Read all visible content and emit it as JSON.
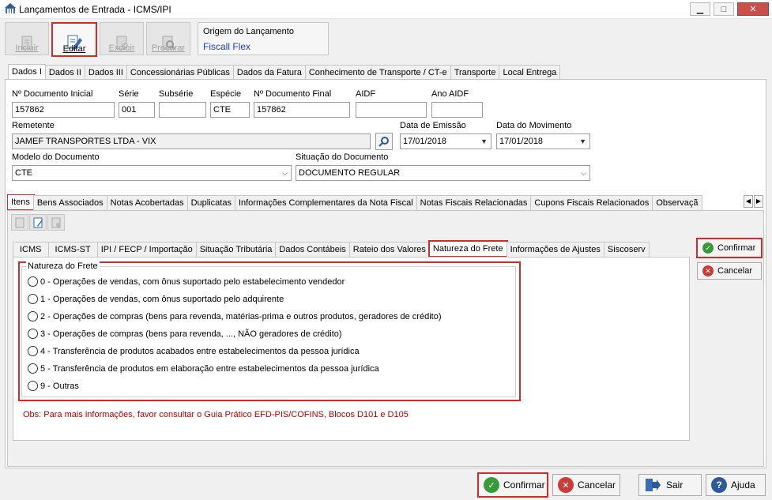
{
  "window": {
    "title": "Lançamentos de Entrada - ICMS/IPI"
  },
  "toolbar": {
    "incluir": "Incluir",
    "editar": "Editar",
    "excluir": "Excluir",
    "procurar": "Procurar"
  },
  "origem": {
    "title": "Origem do Lançamento",
    "value": "Fiscall Flex"
  },
  "main_tabs": [
    "Dados I",
    "Dados II",
    "Dados III",
    "Concessionárias Públicas",
    "Dados da Fatura",
    "Conhecimento de Transporte / CT-e",
    "Transporte",
    "Local Entrega"
  ],
  "form": {
    "num_doc_inicial_label": "Nº Documento Inicial",
    "num_doc_inicial": "157862",
    "serie_label": "Série",
    "serie": "001",
    "subserie_label": "Subsérie",
    "subserie": "",
    "especie_label": "Espécie",
    "especie": "CTE",
    "num_doc_final_label": "Nº Documento Final",
    "num_doc_final": "157862",
    "aidf_label": "AIDF",
    "aidf": "",
    "ano_aidf_label": "Ano AIDF",
    "ano_aidf": "",
    "remetente_label": "Remetente",
    "remetente": "JAMEF TRANSPORTES LTDA -  VIX",
    "data_emissao_label": "Data de Emissão",
    "data_emissao": "17/01/2018",
    "data_movimento_label": "Data do Movimento",
    "data_movimento": "17/01/2018",
    "modelo_label": "Modelo do Documento",
    "modelo": "CTE",
    "situacao_label": "Situação do Documento",
    "situacao": "DOCUMENTO REGULAR"
  },
  "item_tabs": [
    "Itens",
    "Bens Associados",
    "Notas Acobertadas",
    "Duplicatas",
    "Informações Complementares da Nota Fiscal",
    "Notas Fiscais Relacionadas",
    "Cupons Fiscais Relacionados",
    "Observaçã"
  ],
  "tax_tabs": [
    "ICMS",
    "ICMS-ST",
    "IPI / FECP / Importação",
    "Situação Tributária",
    "Dados Contábeis",
    "Rateio dos Valores",
    "Natureza do Frete",
    "Informações de Ajustes",
    "Siscoserv"
  ],
  "natureza": {
    "legend": "Natureza do Frete",
    "options": [
      "0 - Operações de vendas, com ônus suportado pelo estabelecimento vendedor",
      "1 - Operações de vendas, com ônus suportado pelo adquirente",
      "2 - Operações de compras (bens para revenda, matérias-prima e outros produtos, geradores de crédito)",
      "3 - Operações de compras (bens para revenda, ..., NÃO geradores de crédito)",
      "4 - Transferência de produtos acabados entre estabelecimentos da pessoa jurídica",
      "5 - Transferência de produtos em elaboração entre estabelecimentos da pessoa jurídica",
      "9 - Outras"
    ],
    "obs": "Obs: Para mais informações, favor consultar o Guia Prático EFD-PIS/COFINS, Blocos D101 e D105"
  },
  "side": {
    "confirmar": "Confirmar",
    "cancelar": "Cancelar"
  },
  "bottom": {
    "confirmar": "Confirmar",
    "cancelar": "Cancelar",
    "sair": "Sair",
    "ajuda": "Ajuda"
  },
  "colors": {
    "highlight": "#d42a2a",
    "link_blue": "#1f3fcf",
    "obs_red": "#c00000"
  }
}
